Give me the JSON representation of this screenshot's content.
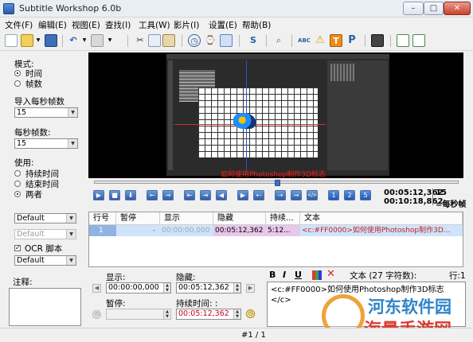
{
  "window": {
    "title": "Subtitle Workshop 6.0b",
    "min": "–",
    "max": "□",
    "close": "✕"
  },
  "menu": [
    "文件(F)",
    "编辑(E)",
    "视图(E)",
    "查找(I)",
    "工具(W)",
    "影片(I)",
    "设置(E)",
    "帮助(B)"
  ],
  "toolbar": {
    "icons": [
      "new-icon",
      "open-icon",
      "dropdown-icon",
      "save-icon",
      "undo-icon",
      "dropdown-icon",
      "saveas-icon",
      "cut-icon",
      "copy-icon",
      "paste-icon",
      "clock-icon",
      "time-icon",
      "comment-icon",
      "translate-icon",
      "search-icon",
      "spellcheck-icon",
      "warning-icon",
      "text-t-icon",
      "pascal-p-icon",
      "film-icon",
      "info-icon",
      "export-icon"
    ]
  },
  "left": {
    "mode_label": "模式:",
    "mode_time": "时间",
    "mode_frames": "帧数",
    "import_fps_label": "导入每秒帧数",
    "import_fps_value": "15",
    "fps_label": "每秒帧数:",
    "fps_value": "15",
    "use_label": "使用:",
    "use_duration": "持续时间",
    "use_end": "结束时间",
    "use_both": "两者",
    "style1": "Default",
    "style2": "Default",
    "ocr_label": "OCR 脚本",
    "ocr_style": "Default",
    "comment_label": "注释:"
  },
  "video": {
    "overlay_text": "如何使用Photoshop制作3D标志"
  },
  "player": {
    "buttons": [
      "▶",
      "■",
      "⬇",
      "←",
      "→",
      "⇤",
      "⇥",
      "◀",
      "▶",
      "⇠",
      "⇢",
      "→",
      "</>",
      "1",
      "2",
      "5"
    ],
    "time_current": "00:05:12,362",
    "time_total": "00:10:18,862",
    "fps_value": "15",
    "fps_unit": "=每秒帧"
  },
  "list": {
    "headers": [
      "行号",
      "暂停",
      "显示",
      "隐藏",
      "持续...",
      "文本"
    ],
    "row": {
      "num": "1",
      "pause": "-",
      "show": "00:00:00,000",
      "hide": "00:05:12,362",
      "duration": "5:12...",
      "text": "<c:#FF0000>如何使用Photoshop制作3D..."
    }
  },
  "edit": {
    "show_label": "显示:",
    "show_value": "00:00:00,000",
    "hide_label": "隐藏:",
    "hide_value": "00:05:12,362",
    "pause_label": "暂停:",
    "pause_value": "",
    "duration_label": "持续时间: :",
    "duration_value": "00:05:12,362",
    "format_bold": "B",
    "format_italic": "I",
    "format_underline": "U",
    "text_info": "文本 (27 字符数):",
    "line_info": "行:1",
    "editor_line1": "<c:#FF0000>如何使用Photoshop制作3D标志",
    "editor_line2": "</c>"
  },
  "watermark": {
    "top": "河东软件园",
    "bottom": "海量手游网"
  },
  "status": {
    "text": "#1 / 1"
  }
}
